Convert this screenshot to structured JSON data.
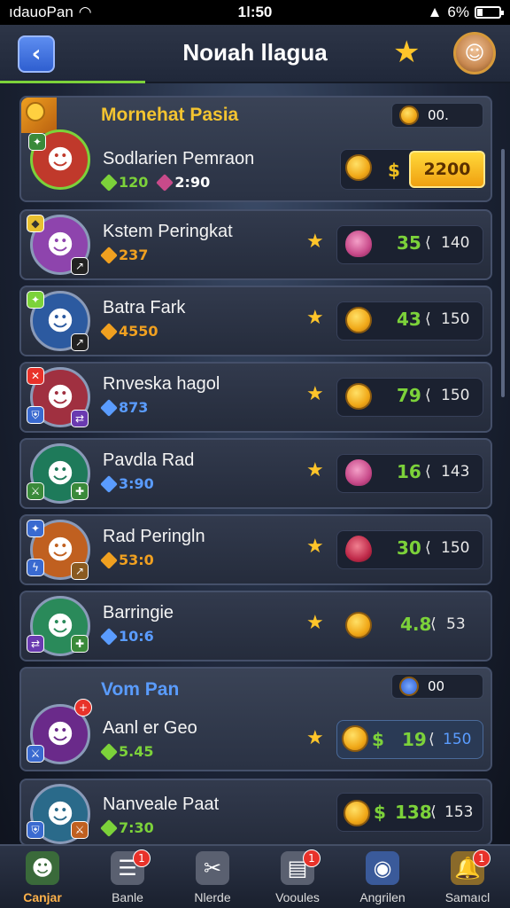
{
  "status_bar": {
    "carrier": "ıdauoPan",
    "time": "1ǀ:50",
    "battery": "6%"
  },
  "header": {
    "title": "Noиah llagua"
  },
  "sections": [
    {
      "title": "Mornehat Pasia",
      "badge_value": "00.",
      "title_color": "#f4c430"
    },
    {
      "title": "Vom Pan",
      "badge_value": "00",
      "title_color": "#5a9cff"
    }
  ],
  "players": [
    {
      "name": "Sodlarien Pemraon",
      "gem_value": "120",
      "gem_color": "#7cd23a",
      "extra": "2:90",
      "icon": "coin",
      "reward": "$",
      "amount": "2200",
      "rank": null,
      "avatar_color": "#c0392b",
      "hair": "#b0302a"
    },
    {
      "name": "Kstem Peringkat",
      "gem_value": "237",
      "gem_color": "#f0a020",
      "icon": "rose",
      "reward": "35",
      "rank": "140",
      "avatar_color": "#8e44ad",
      "hair": "#b050c0"
    },
    {
      "name": "Batra Fark",
      "gem_value": "4550",
      "gem_color": "#f0a020",
      "icon": "coin",
      "reward": "43",
      "rank": "150",
      "avatar_color": "#2c5aa0",
      "hair": "#e0b040"
    },
    {
      "name": "Rnveska hagol",
      "gem_value": "873",
      "gem_color": "#5a9cff",
      "icon": "coin",
      "reward": "79",
      "rank": "150",
      "avatar_color": "#a03040",
      "hair": "#6a3a20"
    },
    {
      "name": "Pavdla Rad",
      "gem_value": "3:90",
      "gem_color": "#5a9cff",
      "icon": "rose",
      "reward": "16",
      "rank": "143",
      "avatar_color": "#1e7a5a",
      "hair": "#2a9a70"
    },
    {
      "name": "Rad Peringln",
      "gem_value": "53:0",
      "gem_color": "#f0a020",
      "icon": "rose-red",
      "reward": "30",
      "rank": "150",
      "avatar_color": "#c06020",
      "hair": "#a05a20"
    },
    {
      "name": "Barringie",
      "gem_value": "10:6",
      "gem_color": "#5a9cff",
      "icon": "coin",
      "reward": "4.8",
      "rank": "53",
      "avatar_color": "#2a8a5a",
      "hair": "#2aa070"
    },
    {
      "name": "Aanl er Geo",
      "gem_value": "5.45",
      "gem_color": "#7cd23a",
      "icon": "coin",
      "reward_prefix": "$",
      "reward": "19",
      "rank": "150",
      "avatar_color": "#6a2a8a",
      "hair": "#8a3ab0"
    },
    {
      "name": "Nanveale Paat",
      "gem_value": "7:30",
      "gem_color": "#7cd23a",
      "icon": "coin",
      "reward_prefix": "$",
      "reward": "138",
      "rank": "153",
      "avatar_color": "#2a6a8a",
      "hair": "#2a9aa0"
    }
  ],
  "nav": [
    {
      "label": "Canjar",
      "icon": "hero-icon",
      "badge": null
    },
    {
      "label": "Banle",
      "icon": "list-icon",
      "badge": "1"
    },
    {
      "label": "Nlerde",
      "icon": "tools-icon",
      "badge": null
    },
    {
      "label": "Vooules",
      "icon": "book-icon",
      "badge": "1"
    },
    {
      "label": "Angrilen",
      "icon": "trophy-icon",
      "badge": null
    },
    {
      "label": "Samaıcl",
      "icon": "bell-icon",
      "badge": "1"
    }
  ],
  "colors": {
    "accent": "#ffc52a",
    "green": "#7cd23a",
    "blue": "#5a9cff"
  }
}
